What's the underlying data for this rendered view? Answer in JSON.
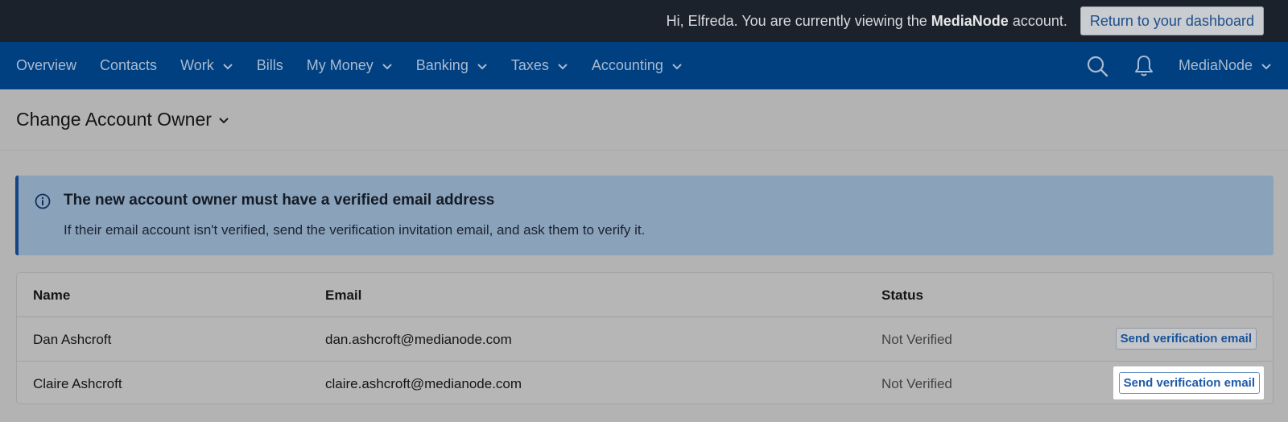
{
  "topbar": {
    "greeting_prefix": "Hi, Elfreda. You are currently viewing the ",
    "account_name": "MediaNode",
    "greeting_suffix": " account.",
    "return_label": "Return to your dashboard"
  },
  "nav": {
    "items": [
      {
        "label": "Overview",
        "dropdown": false
      },
      {
        "label": "Contacts",
        "dropdown": false
      },
      {
        "label": "Work",
        "dropdown": true
      },
      {
        "label": "Bills",
        "dropdown": false
      },
      {
        "label": "My Money",
        "dropdown": true
      },
      {
        "label": "Banking",
        "dropdown": true
      },
      {
        "label": "Taxes",
        "dropdown": true
      },
      {
        "label": "Accounting",
        "dropdown": true
      }
    ],
    "account_label": "MediaNode",
    "icons": [
      "search-icon",
      "bell-icon"
    ]
  },
  "page": {
    "title": "Change Account Owner"
  },
  "alert": {
    "title": "The new account owner must have a verified email address",
    "body": "If their email account isn't verified, send the verification invitation email, and ask them to verify it."
  },
  "table": {
    "headers": {
      "name": "Name",
      "email": "Email",
      "status": "Status"
    },
    "rows": [
      {
        "name": "Dan Ashcroft",
        "email": "dan.ashcroft@medianode.com",
        "status": "Not Verified",
        "action": "Send verification email"
      },
      {
        "name": "Claire Ashcroft",
        "email": "claire.ashcroft@medianode.com",
        "status": "Not Verified",
        "action": "Send verification email"
      }
    ]
  },
  "colors": {
    "topbar_bg": "#1c222b",
    "nav_bg": "#003f80",
    "alert_bg": "#8ba2bb",
    "link_blue": "#17539a"
  }
}
